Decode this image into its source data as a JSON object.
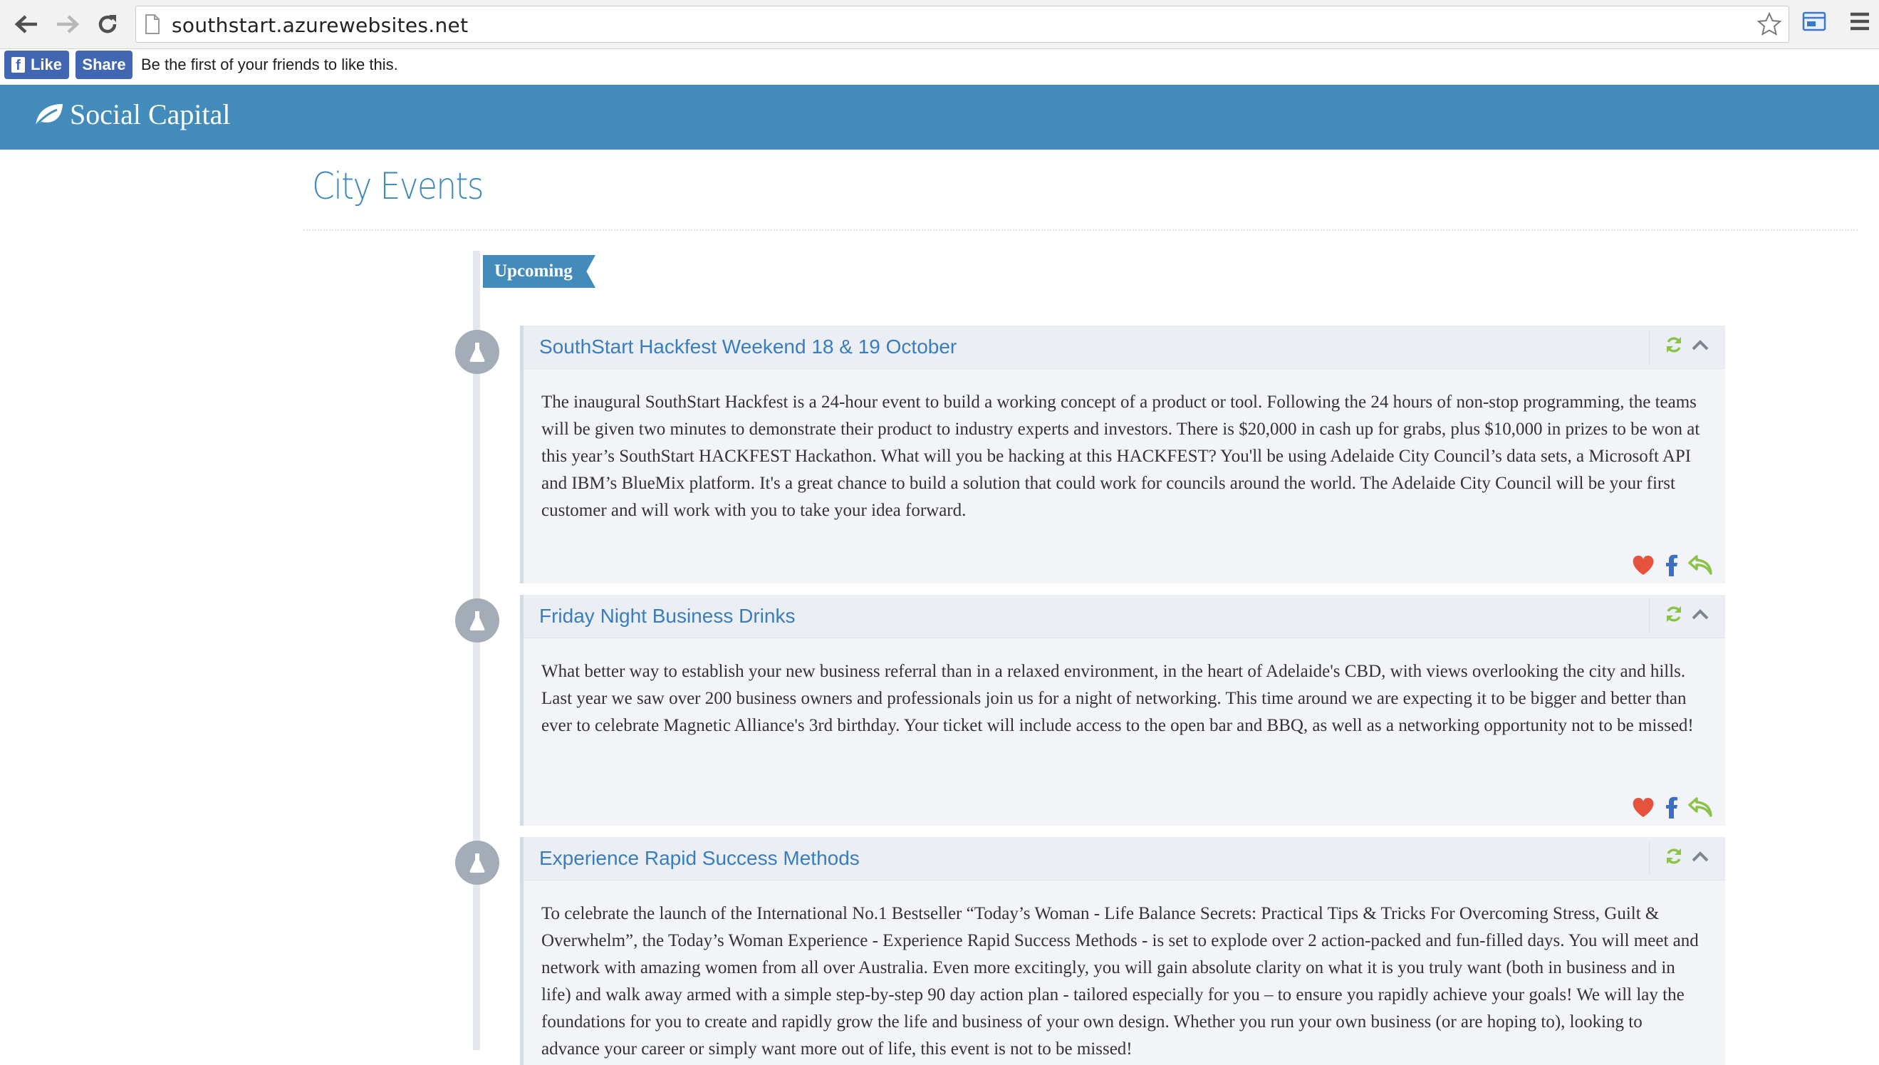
{
  "browser": {
    "url": "southstart.azurewebsites.net"
  },
  "facebook": {
    "like_label": "Like",
    "share_label": "Share",
    "social_text": "Be the first of your friends to like this."
  },
  "site": {
    "brand": "Social Capital",
    "brand_color": "#428bbb"
  },
  "page": {
    "title": "City Events"
  },
  "timeline": {
    "section_label": "Upcoming",
    "events": [
      {
        "title": "SouthStart Hackfest Weekend 18 & 19 October",
        "description": "The inaugural SouthStart Hackfest is a 24-hour event to build a working concept of a product or tool. Following the 24 hours of non-stop programming, the teams will be given two minutes to demonstrate their product to industry experts and investors. There is $20,000 in cash up for grabs, plus $10,000 in prizes to be won at this year’s SouthStart HACKFEST Hackathon. What will you be hacking at this HACKFEST? You'll be using Adelaide City Council’s data sets, a Microsoft API and IBM’s BlueMix platform. It's a great chance to build a solution that could work for councils around the world. The Adelaide City Council will be your first customer and will work with you to take your idea forward."
      },
      {
        "title": "Friday Night Business Drinks",
        "description": "What better way to establish your new business referral than in a relaxed environment, in the heart of Adelaide's CBD, with views overlooking the city and hills. Last year we saw over 200 business owners and professionals join us for a night of networking. This time around we are expecting it to be bigger and better than ever to celebrate Magnetic Alliance's 3rd birthday. Your ticket will include access to the open bar and BBQ, as well as a networking opportunity not to be missed!"
      },
      {
        "title": "Experience Rapid Success Methods",
        "description": "To celebrate the launch of the International No.1 Bestseller “Today’s Woman - Life Balance Secrets: Practical Tips & Tricks For Overcoming Stress, Guilt & Overwhelm”, the Today’s Woman Experience - Experience Rapid Success Methods - is set to explode over 2 action-packed and fun-filled days. You will meet and network with amazing women from all over Australia. Even more excitingly, you will gain absolute clarity on what it is you truly want (both in business and in life) and walk away armed with a simple step-by-step 90 day action plan - tailored especially for you – to ensure you rapidly achieve your goals! We will lay the foundations for you to create and rapidly grow the life and business of your own design. Whether you run your own business (or are hoping to), looking to advance your career or simply want more out of life, this event is not to be missed!"
      }
    ]
  },
  "icons": {
    "back": "arrow-left-icon",
    "forward": "arrow-right-icon",
    "reload": "reload-icon",
    "bookmark": "star-icon",
    "timeline_marker": "flask-icon",
    "refresh": "refresh-icon",
    "collapse": "chevron-up-icon",
    "like": "heart-icon",
    "share_facebook": "facebook-icon",
    "reply": "reply-icon"
  }
}
